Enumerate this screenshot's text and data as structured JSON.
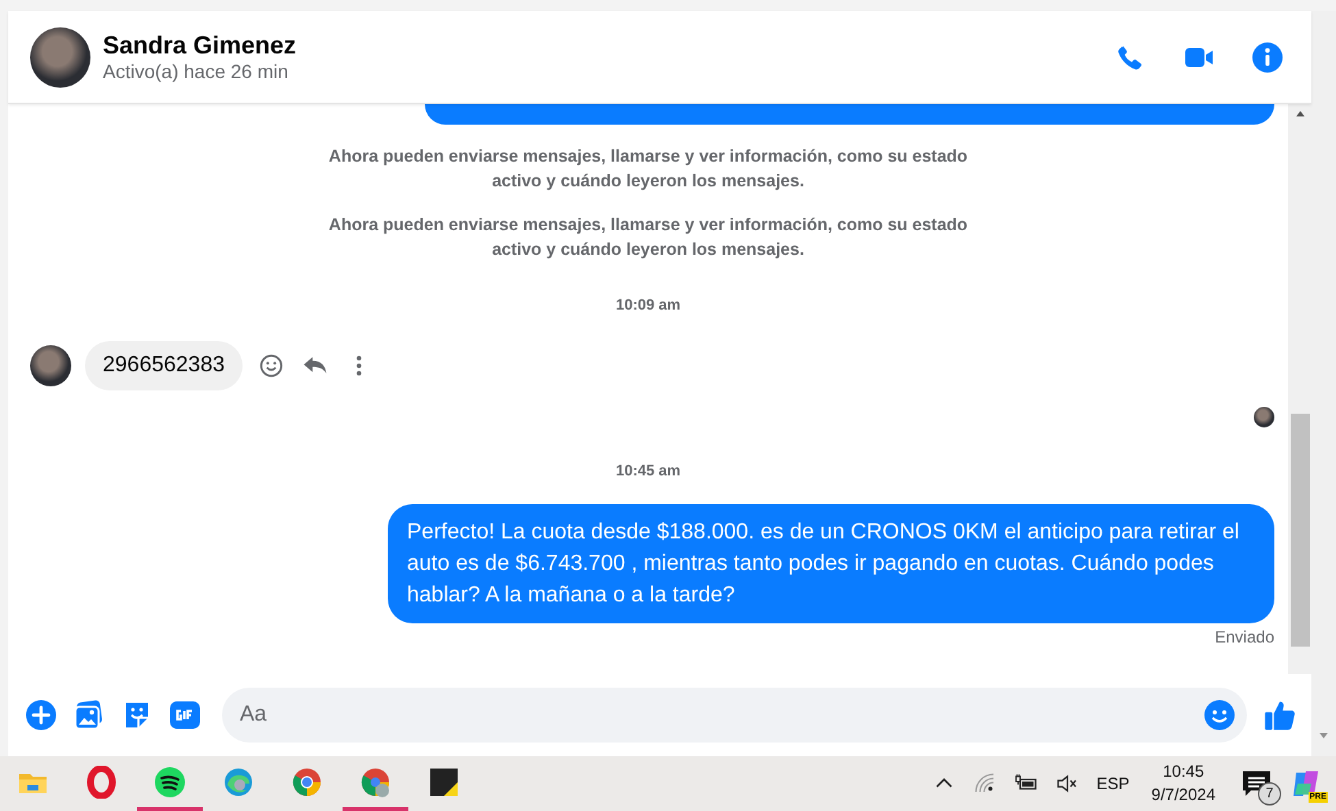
{
  "header": {
    "name": "Sandra Gimenez",
    "status": "Activo(a) hace 26 min"
  },
  "messages": [
    {
      "kind": "clipped-sent"
    },
    {
      "kind": "system",
      "text": "Ahora pueden enviarse mensajes, llamarse y ver información, como su estado activo y cuándo leyeron los mensajes."
    },
    {
      "kind": "system",
      "text": "Ahora pueden enviarse mensajes, llamarse y ver información, como su estado activo y cuándo leyeron los mensajes."
    },
    {
      "kind": "time",
      "text": "10:09 am"
    },
    {
      "kind": "received",
      "text": "2966562383"
    },
    {
      "kind": "seen"
    },
    {
      "kind": "time",
      "text": "10:45 am"
    },
    {
      "kind": "sent",
      "text": "Perfecto! La cuota desde $188.000. es de un CRONOS 0KM el anticipo para retirar el auto es de $6.743.700 , mientras tanto podes ir pagando en cuotas. Cuándo podes hablar? A la mañana o a la tarde?"
    },
    {
      "kind": "status",
      "text": "Enviado"
    }
  ],
  "composer": {
    "placeholder": "Aa"
  },
  "taskbar": {
    "apps": [
      {
        "kind": "folder",
        "active": false
      },
      {
        "kind": "opera",
        "active": false
      },
      {
        "kind": "spotify",
        "active": true
      },
      {
        "kind": "edge",
        "active": false
      },
      {
        "kind": "chrome",
        "active": false
      },
      {
        "kind": "chrome-profile",
        "active": true
      },
      {
        "kind": "sticky",
        "active": false
      }
    ],
    "language": "ESP",
    "time": "10:45",
    "date": "9/7/2024",
    "notifications": "7",
    "app_badge": "PRE"
  }
}
